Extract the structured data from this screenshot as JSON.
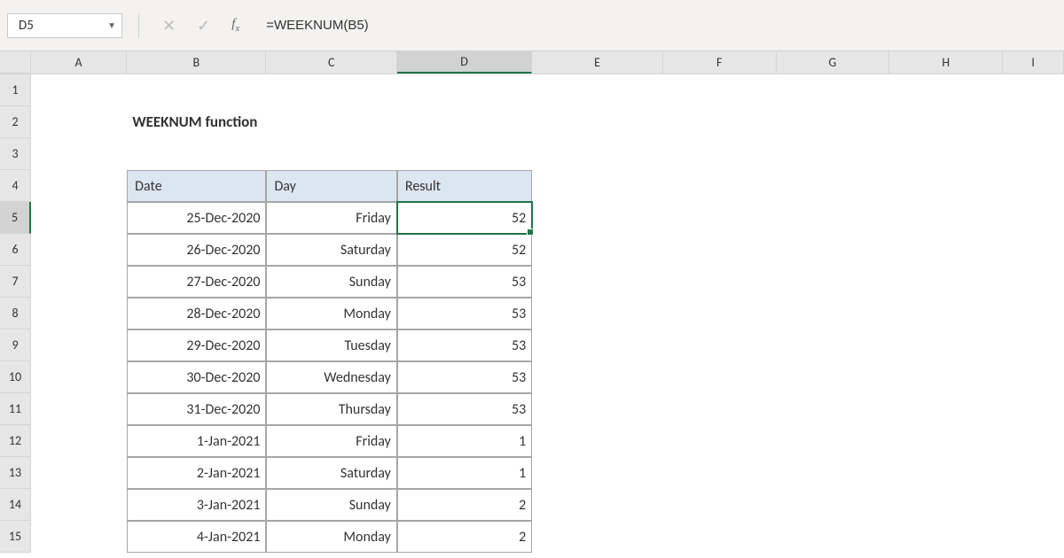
{
  "formula_bar": {
    "cell_ref": "D5",
    "formula": "=WEEKNUM(B5)"
  },
  "columns": [
    "A",
    "B",
    "C",
    "D",
    "E",
    "F",
    "G",
    "H",
    "I"
  ],
  "selected_col": "D",
  "selected_row": 5,
  "title": "WEEKNUM function",
  "headers": {
    "date": "Date",
    "day": "Day",
    "result": "Result"
  },
  "rows": [
    {
      "date": "25-Dec-2020",
      "day": "Friday",
      "result": "52"
    },
    {
      "date": "26-Dec-2020",
      "day": "Saturday",
      "result": "52"
    },
    {
      "date": "27-Dec-2020",
      "day": "Sunday",
      "result": "53"
    },
    {
      "date": "28-Dec-2020",
      "day": "Monday",
      "result": "53"
    },
    {
      "date": "29-Dec-2020",
      "day": "Tuesday",
      "result": "53"
    },
    {
      "date": "30-Dec-2020",
      "day": "Wednesday",
      "result": "53"
    },
    {
      "date": "31-Dec-2020",
      "day": "Thursday",
      "result": "53"
    },
    {
      "date": "1-Jan-2021",
      "day": "Friday",
      "result": "1"
    },
    {
      "date": "2-Jan-2021",
      "day": "Saturday",
      "result": "1"
    },
    {
      "date": "3-Jan-2021",
      "day": "Sunday",
      "result": "2"
    },
    {
      "date": "4-Jan-2021",
      "day": "Monday",
      "result": "2"
    }
  ]
}
